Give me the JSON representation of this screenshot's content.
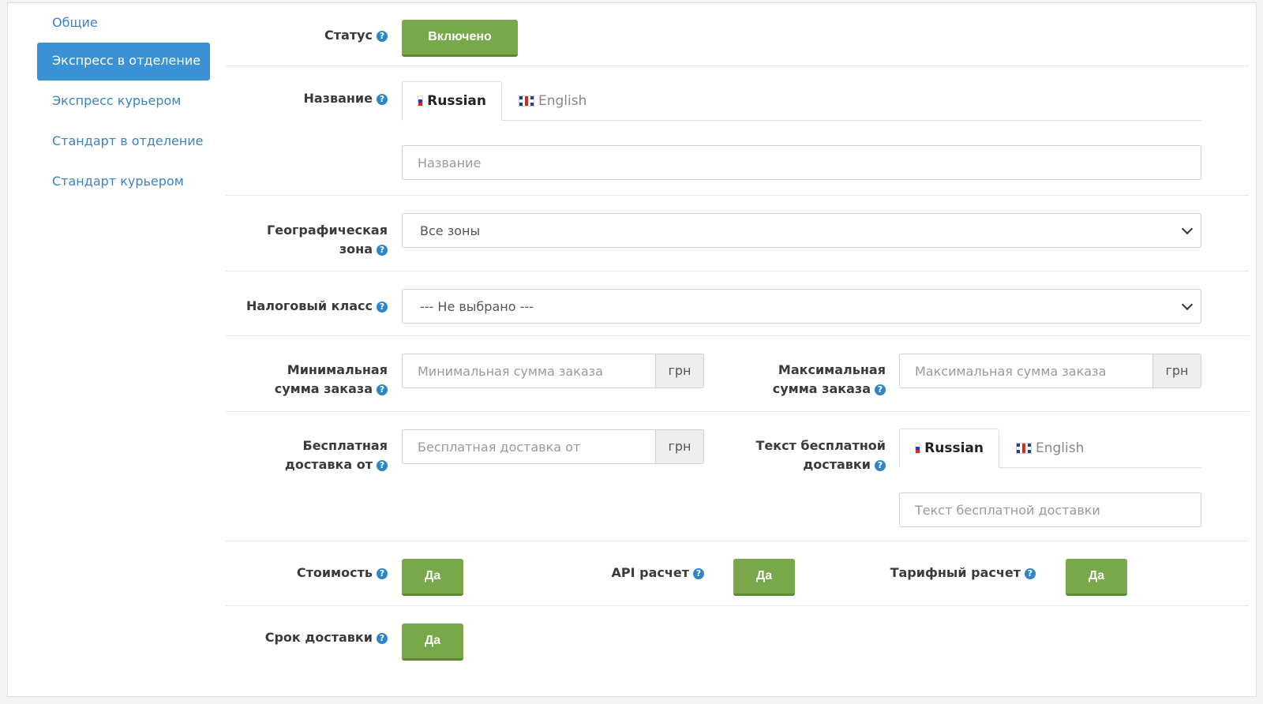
{
  "sidebar": {
    "items": [
      {
        "label": "Общие"
      },
      {
        "label": "Экспресс в отделение"
      },
      {
        "label": "Экспресс курьером"
      },
      {
        "label": "Стандарт в отделение"
      },
      {
        "label": "Стандарт курьером"
      }
    ],
    "active_index": 1
  },
  "form": {
    "status": {
      "label": "Статус",
      "button": "Включено"
    },
    "name": {
      "label": "Название",
      "tabs": [
        {
          "label": "Russian"
        },
        {
          "label": "English"
        }
      ],
      "placeholder": "Название"
    },
    "geo_zone": {
      "label_line1": "Географическая",
      "label_line2": "зона",
      "value": "Все зоны"
    },
    "tax_class": {
      "label": "Налоговый класс",
      "value": "--- Не выбрано ---"
    },
    "min_order": {
      "label_line1": "Минимальная",
      "label_line2": "сумма заказа",
      "placeholder": "Минимальная сумма заказа",
      "currency": "грн"
    },
    "max_order": {
      "label_line1": "Максимальная",
      "label_line2": "сумма заказа",
      "placeholder": "Максимальная сумма заказа",
      "currency": "грн"
    },
    "free_shipping": {
      "label_line1": "Бесплатная",
      "label_line2": "доставка от",
      "placeholder": "Бесплатная доставка от",
      "currency": "грн"
    },
    "free_text": {
      "label_line1": "Текст бесплатной",
      "label_line2": "доставки",
      "tabs": [
        {
          "label": "Russian"
        },
        {
          "label": "English"
        }
      ],
      "placeholder": "Текст бесплатной доставки"
    },
    "cost": {
      "label": "Стоимость",
      "button": "Да"
    },
    "api_calc": {
      "label": "API расчет",
      "button": "Да"
    },
    "tariff_calc": {
      "label": "Тарифный расчет",
      "button": "Да"
    },
    "delivery_time": {
      "label": "Срок доставки",
      "button": "Да"
    }
  },
  "colors": {
    "primary": "#3a91d3",
    "success": "#78a849",
    "link": "#3c82c4"
  }
}
